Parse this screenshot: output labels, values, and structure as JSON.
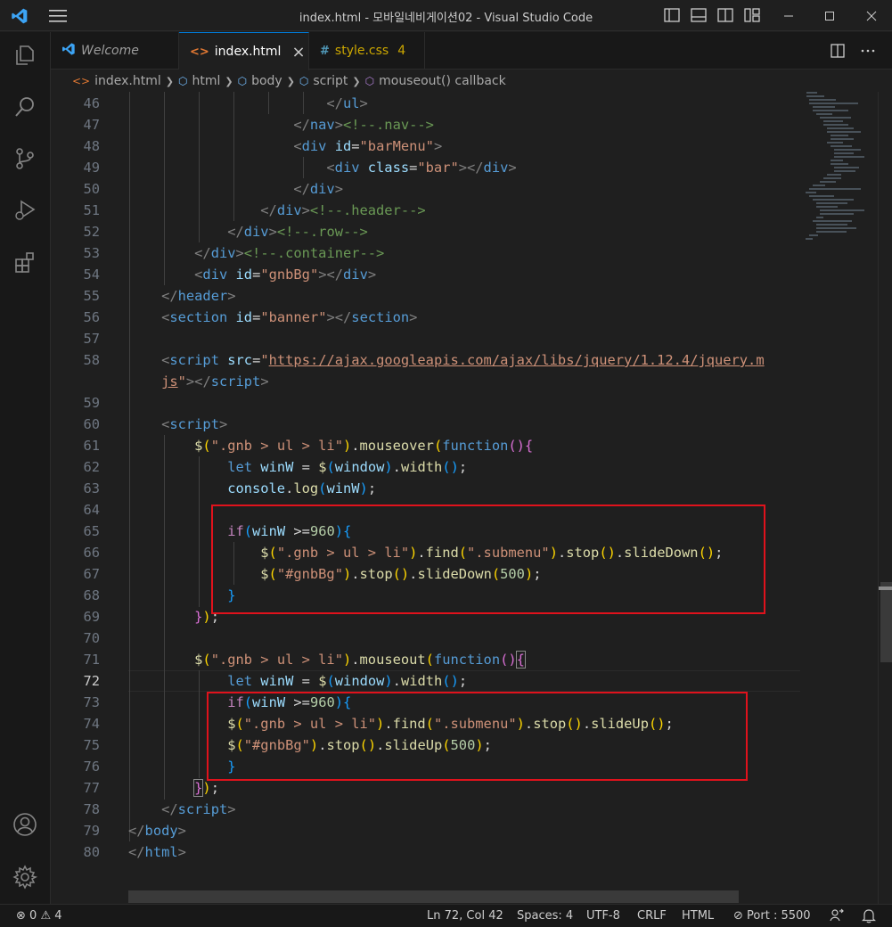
{
  "window": {
    "title": "index.html - 모바일네비게이션02 - Visual Studio Code"
  },
  "tabs": [
    {
      "label": "Welcome",
      "icon": "vscode-icon"
    },
    {
      "label": "index.html",
      "icon": "html-icon",
      "close": "×"
    },
    {
      "label": "style.css",
      "icon": "css-icon",
      "badge": "4"
    }
  ],
  "breadcrumb": [
    "index.html",
    "html",
    "body",
    "script",
    "mouseout() callback"
  ],
  "editor": {
    "current_line": 72,
    "line_numbers": [
      "46",
      "47",
      "48",
      "49",
      "50",
      "51",
      "52",
      "53",
      "54",
      "55",
      "56",
      "57",
      "58",
      "",
      "59",
      "60",
      "61",
      "62",
      "63",
      "64",
      "65",
      "66",
      "67",
      "68",
      "69",
      "70",
      "71",
      "72",
      "73",
      "74",
      "75",
      "76",
      "77",
      "78",
      "79",
      "80"
    ]
  },
  "statusbar": {
    "errors": "0",
    "warnings": "4",
    "position": "Ln 72, Col 42",
    "spaces": "Spaces: 4",
    "encoding": "UTF-8",
    "eol": "CRLF",
    "language": "HTML",
    "port": "Port : 5500"
  },
  "colors": {
    "accent": "#0078d4",
    "highlight_box": "#e0121c",
    "background": "#1f1f1f"
  }
}
